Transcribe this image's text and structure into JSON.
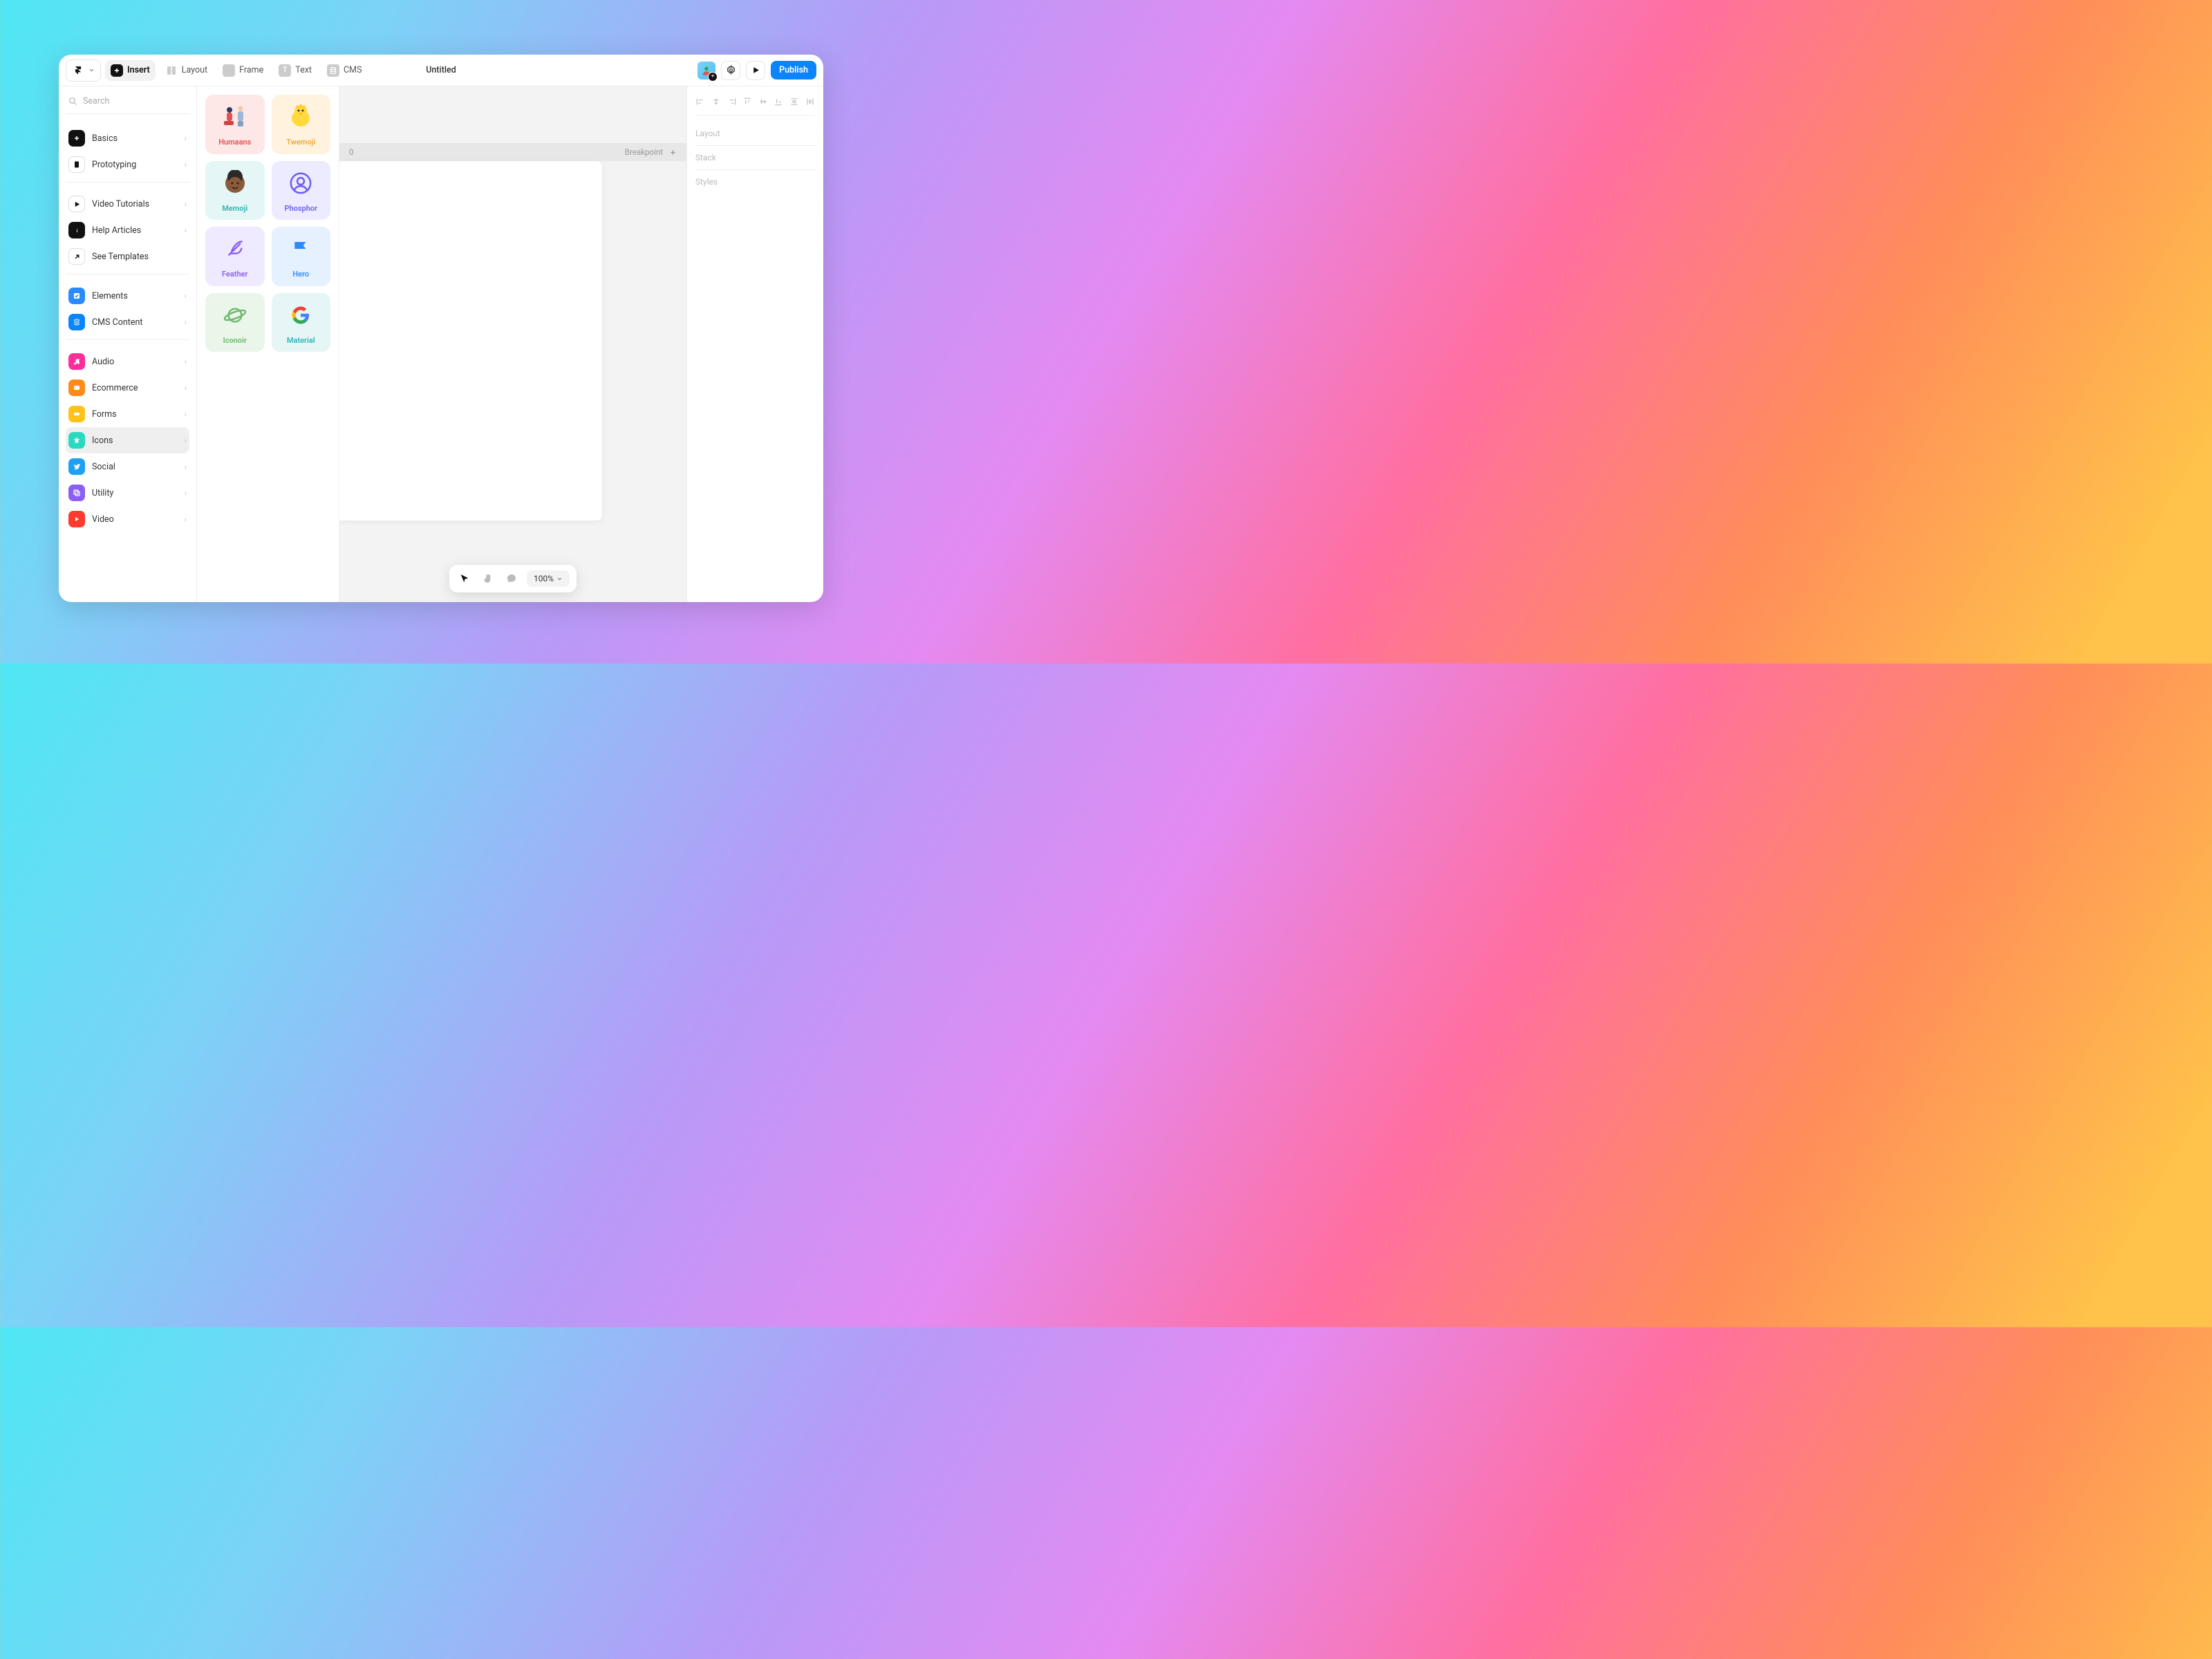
{
  "toolbar": {
    "insert": "Insert",
    "layout": "Layout",
    "frame": "Frame",
    "text": "Text",
    "cms": "CMS",
    "title": "Untitled",
    "publish": "Publish"
  },
  "search": {
    "placeholder": "Search"
  },
  "sidebar": {
    "primary": [
      {
        "label": "Basics"
      },
      {
        "label": "Prototyping"
      }
    ],
    "help": [
      {
        "label": "Video Tutorials"
      },
      {
        "label": "Help Articles"
      },
      {
        "label": "See Templates"
      }
    ],
    "content": [
      {
        "label": "Elements"
      },
      {
        "label": "CMS Content"
      }
    ],
    "categories": [
      {
        "label": "Audio"
      },
      {
        "label": "Ecommerce"
      },
      {
        "label": "Forms"
      },
      {
        "label": "Icons"
      },
      {
        "label": "Social"
      },
      {
        "label": "Utility"
      },
      {
        "label": "Video"
      }
    ]
  },
  "icon_packs": [
    {
      "label": "Humaans"
    },
    {
      "label": "Twemoji"
    },
    {
      "label": "Memoji"
    },
    {
      "label": "Phosphor"
    },
    {
      "label": "Feather"
    },
    {
      "label": "Hero"
    },
    {
      "label": "Iconoir"
    },
    {
      "label": "Material"
    }
  ],
  "canvas": {
    "bp_value": "0",
    "bp_label": "Breakpoint"
  },
  "right_panel": {
    "layout": "Layout",
    "stack": "Stack",
    "styles": "Styles"
  },
  "bottombar": {
    "zoom": "100%"
  }
}
